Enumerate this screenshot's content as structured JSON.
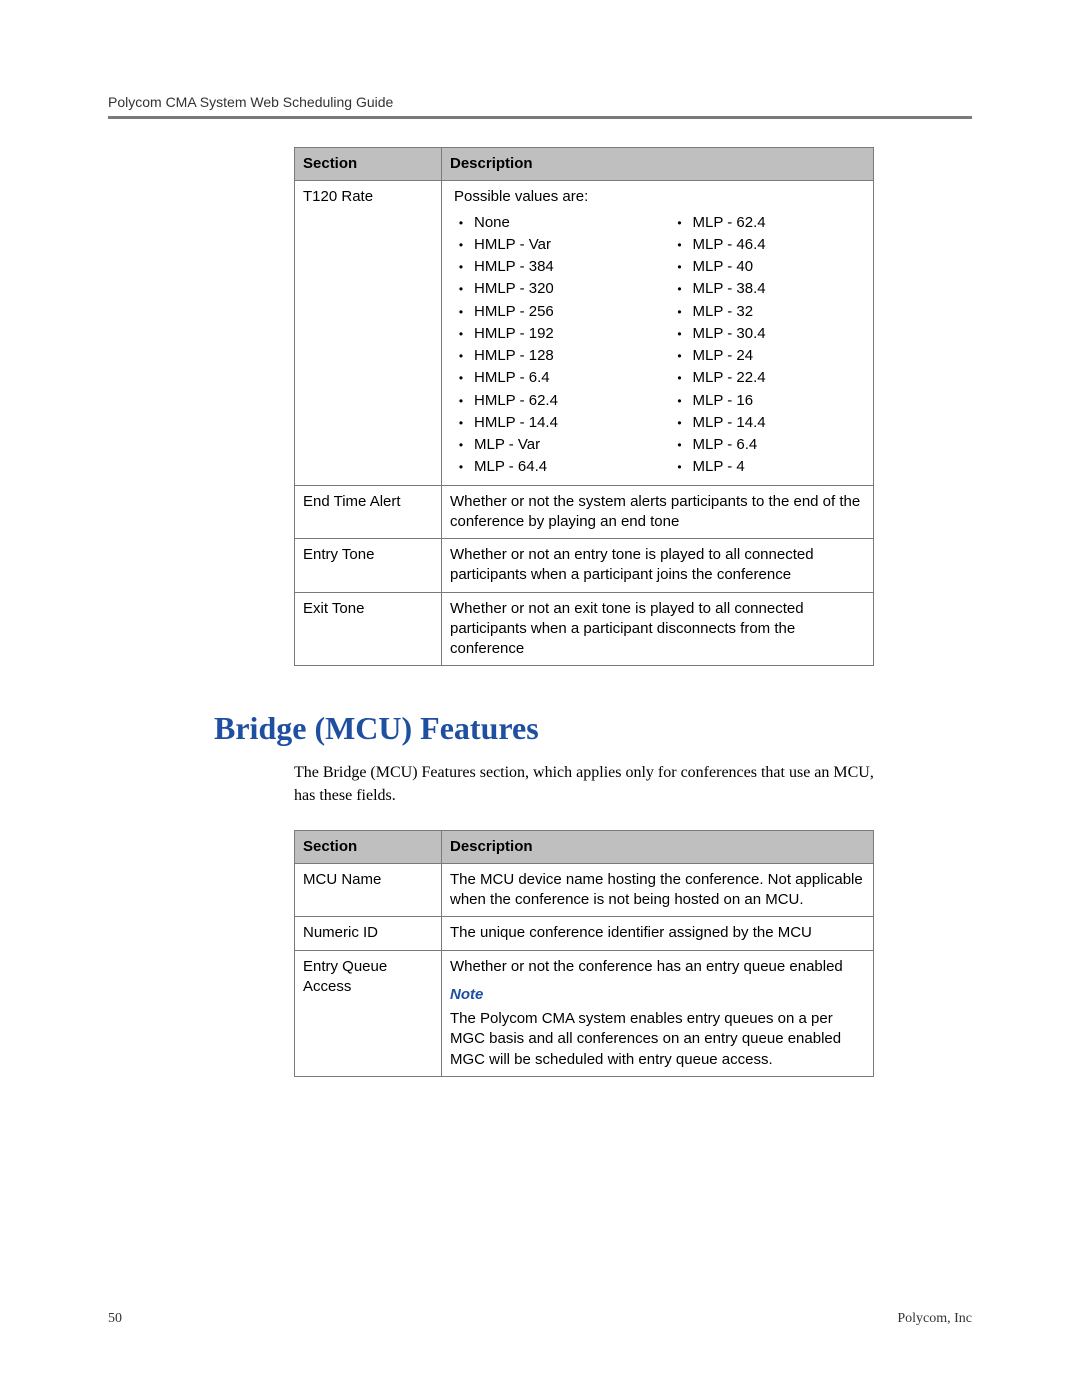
{
  "header": {
    "running_title": "Polycom CMA System Web Scheduling Guide"
  },
  "table1": {
    "col_section": "Section",
    "col_description": "Description",
    "rows": {
      "t120": {
        "section": "T120 Rate",
        "intro": "Possible values are:",
        "left": [
          "None",
          "HMLP - Var",
          "HMLP - 384",
          "HMLP - 320",
          "HMLP - 256",
          "HMLP - 192",
          "HMLP - 128",
          "HMLP - 6.4",
          "HMLP - 62.4",
          "HMLP - 14.4",
          "MLP - Var",
          "MLP - 64.4"
        ],
        "right": [
          "MLP - 62.4",
          "MLP - 46.4",
          "MLP - 40",
          "MLP - 38.4",
          "MLP - 32",
          "MLP - 30.4",
          "MLP - 24",
          "MLP - 22.4",
          "MLP - 16",
          "MLP - 14.4",
          "MLP - 6.4",
          "MLP - 4"
        ]
      },
      "end_time_alert": {
        "section": "End Time Alert",
        "desc": "Whether or not the system alerts participants to the end of the conference by playing an end tone"
      },
      "entry_tone": {
        "section": "Entry Tone",
        "desc": "Whether or not an entry tone is played to all connected participants when a participant joins the conference"
      },
      "exit_tone": {
        "section": "Exit Tone",
        "desc": "Whether or not an exit tone is played to all connected participants when a participant disconnects from the conference"
      }
    }
  },
  "heading": "Bridge (MCU) Features",
  "intro_para": "The Bridge (MCU) Features section, which applies only for conferences that use an MCU, has these fields.",
  "table2": {
    "col_section": "Section",
    "col_description": "Description",
    "rows": {
      "mcu_name": {
        "section": "MCU Name",
        "desc": "The MCU device name hosting the conference. Not applicable when the conference is not being hosted on an MCU."
      },
      "numeric_id": {
        "section": "Numeric ID",
        "desc": "The unique conference identifier assigned by the MCU"
      },
      "entry_queue": {
        "section": "Entry Queue Access",
        "desc": "Whether or not the conference has an entry queue enabled",
        "note_label": "Note",
        "note_body": "The Polycom CMA system enables entry queues on a per MGC basis and all conferences on an entry queue enabled MGC will be scheduled with entry queue access."
      }
    }
  },
  "footer": {
    "page_number": "50",
    "company": "Polycom, Inc"
  }
}
